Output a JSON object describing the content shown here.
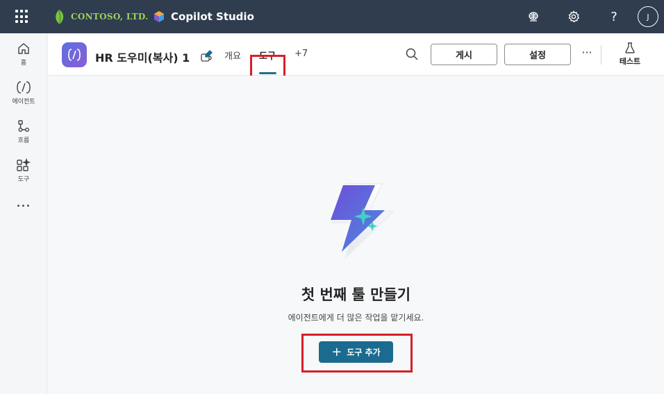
{
  "header": {
    "brand": "CONTOSO, LTD.",
    "product": "Copilot Studio",
    "avatar_initial": "J",
    "icons": [
      "waffle-icon",
      "leaf-logo-icon",
      "copilot-studio-logo-icon",
      "environment-icon",
      "settings-gear-icon",
      "help-icon"
    ],
    "help_glyph": "?"
  },
  "rail": {
    "items": [
      {
        "label": "홈",
        "icon": "home-icon"
      },
      {
        "label": "에이전트",
        "icon": "agents-icon"
      },
      {
        "label": "흐름",
        "icon": "flows-icon"
      },
      {
        "label": "도구",
        "icon": "tools-icon"
      }
    ],
    "more_glyph": "•••"
  },
  "agent": {
    "title": "HR 도우미(복사) 1",
    "tabs": [
      {
        "label": "개요",
        "active": false
      },
      {
        "label": "도구",
        "active": true
      },
      {
        "label": "+7",
        "active": false
      }
    ],
    "publish_label": "게시",
    "settings_label": "설정",
    "more_glyph": "···",
    "test_label": "테스트"
  },
  "main": {
    "heading": "첫 번째 툴 만들기",
    "subtitle": "에이전트에게 더 많은 작업을 맡기세요.",
    "add_button_label": "도구 추가",
    "add_glyph": "+"
  },
  "colors": {
    "topbar": "#2f3d4f",
    "accent": "#1a6b8f",
    "highlight": "#d61f26",
    "brand_green": "#9bd35a"
  }
}
